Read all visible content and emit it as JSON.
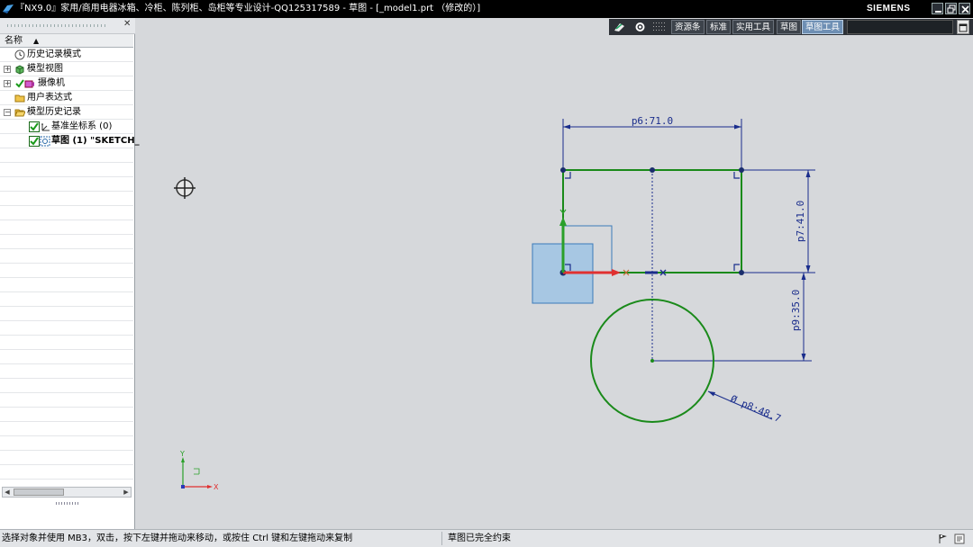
{
  "window": {
    "title": "『NX9.0』家用/商用电器冰箱、冷柜、陈列柜、岛柜等专业设计-QQ125317589 - 草图 - [_model1.prt （修改的）]",
    "brand": "SIEMENS"
  },
  "toolbar": {
    "tabs": [
      {
        "label": "资源条",
        "active": false
      },
      {
        "label": "标准",
        "active": false
      },
      {
        "label": "实用工具",
        "active": false
      },
      {
        "label": "草图",
        "active": false
      },
      {
        "label": "草图工具",
        "active": true
      }
    ]
  },
  "navigator": {
    "column_header": "名称",
    "items": [
      {
        "label": "历史记录模式",
        "icon": "clock-icon"
      },
      {
        "label": "模型视图",
        "icon": "model-views-icon"
      },
      {
        "label": "摄像机",
        "icon": "camera-icon"
      },
      {
        "label": "用户表达式",
        "icon": "folder-icon"
      },
      {
        "label": "模型历史记录",
        "icon": "folder-open-icon"
      },
      {
        "label": "基准坐标系 (0)",
        "icon": "datum-csys-icon",
        "checked": true
      },
      {
        "label": "草图 (1) \"SKETCH_",
        "icon": "sketch-icon",
        "checked": true
      }
    ]
  },
  "sketch": {
    "dimensions": [
      {
        "name": "p6",
        "value": "71.0",
        "label": "p6:71.0"
      },
      {
        "name": "p7",
        "value": "41.0",
        "label": "p7:41.0"
      },
      {
        "name": "p9",
        "value": "35.0",
        "label": "p9:35.0"
      },
      {
        "name": "p8",
        "value": "48.7",
        "label": "Ø p8:48.7"
      }
    ],
    "colors": {
      "geometry": "#1a8a1a",
      "dimension": "#1a2d8c",
      "x_axis": "#e03030",
      "y_axis": "#2aa02a"
    }
  },
  "triad": {
    "x_label": "X",
    "y_label": "Y"
  },
  "status": {
    "prompt": "选择对象并使用 MB3，双击，按下左键并拖动来移动，或按住 Ctrl 键和左键拖动来复制",
    "message": "草图已完全约束"
  }
}
